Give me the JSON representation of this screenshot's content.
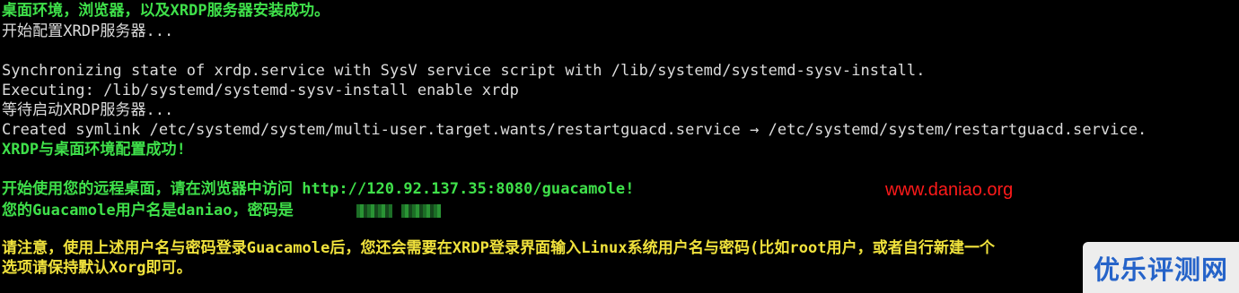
{
  "terminal": {
    "lines": {
      "l1": "桌面环境，浏览器，以及XRDP服务器安装成功。",
      "l2": "开始配置XRDP服务器...",
      "l3": "Synchronizing state of xrdp.service with SysV service script with /lib/systemd/systemd-sysv-install.",
      "l4": "Executing: /lib/systemd/systemd-sysv-install enable xrdp",
      "l5": "等待启动XRDP服务器...",
      "l6": "Created symlink /etc/systemd/system/multi-user.target.wants/restartguacd.service → /etc/systemd/system/restartguacd.service.",
      "l7": "XRDP与桌面环境配置成功!",
      "l8": "开始使用您的远程桌面，请在浏览器中访问 http://120.92.137.35:8080/guacamole!",
      "l9": "您的Guacamole用户名是daniao，密码是",
      "l10": "请注意，使用上述用户名与密码登录Guacamole后，您还会需要在XRDP登录界面输入Linux系统用户名与密码(比如root用户，或者自行新建一个",
      "l11": "选项请保持默认Xorg即可。"
    },
    "colors": {
      "background": "#000000",
      "normal_text": "#dcdcdc",
      "success_text": "#3fe04a",
      "notice_text": "#f0e23c"
    }
  },
  "watermark": {
    "site": "www.daniao.org",
    "color": "#ff1a1a"
  },
  "logo": {
    "text": "优乐评测网",
    "color": "#2563c9"
  }
}
